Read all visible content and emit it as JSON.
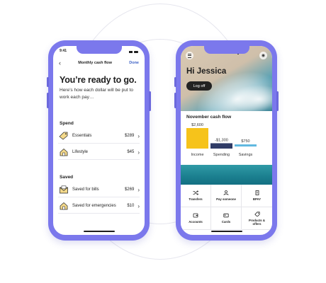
{
  "left_phone": {
    "status_time": "9:41",
    "nav": {
      "back_icon": "chevron-left-icon",
      "title": "Monthly cash flow",
      "done_label": "Done"
    },
    "headline": "You’re ready to go.",
    "subtext": "Here’s how each dollar will be put to work each pay…",
    "sections": [
      {
        "label": "Spend",
        "items": [
          {
            "label": "Essentials",
            "amount": "$289",
            "icon": "tag-icon"
          },
          {
            "label": "Lifestyle",
            "amount": "$45",
            "icon": "house-icon"
          }
        ]
      },
      {
        "label": "Saved",
        "items": [
          {
            "label": "Saved for bills",
            "amount": "$269",
            "icon": "envelope-icon"
          },
          {
            "label": "Saved for emergencies",
            "amount": "$10",
            "icon": "house-icon"
          }
        ]
      }
    ]
  },
  "right_phone": {
    "greeting": "Hi Jessica",
    "logoff_label": "Log off",
    "cash_flow_title": "November cash flow",
    "tiles": [
      {
        "label": "Transfers",
        "icon": "shuffle-icon"
      },
      {
        "label": "Pay someone",
        "icon": "person-icon"
      },
      {
        "label": "BPAY",
        "icon": "receipt-icon"
      },
      {
        "label": "Accounts",
        "icon": "wallet-icon"
      },
      {
        "label": "Cards",
        "icon": "card-icon"
      },
      {
        "label": "Products & offers",
        "icon": "tag-icon"
      }
    ]
  },
  "chart_data": {
    "type": "bar",
    "title": "November cash flow",
    "categories": [
      "Income",
      "Spending",
      "Savings"
    ],
    "values": [
      2600,
      -1300,
      750
    ],
    "value_labels": [
      "$2,600",
      "-$1,300",
      "$750"
    ],
    "colors": [
      "#f6c31b",
      "#2f3b66",
      "#5fb8e0"
    ]
  }
}
